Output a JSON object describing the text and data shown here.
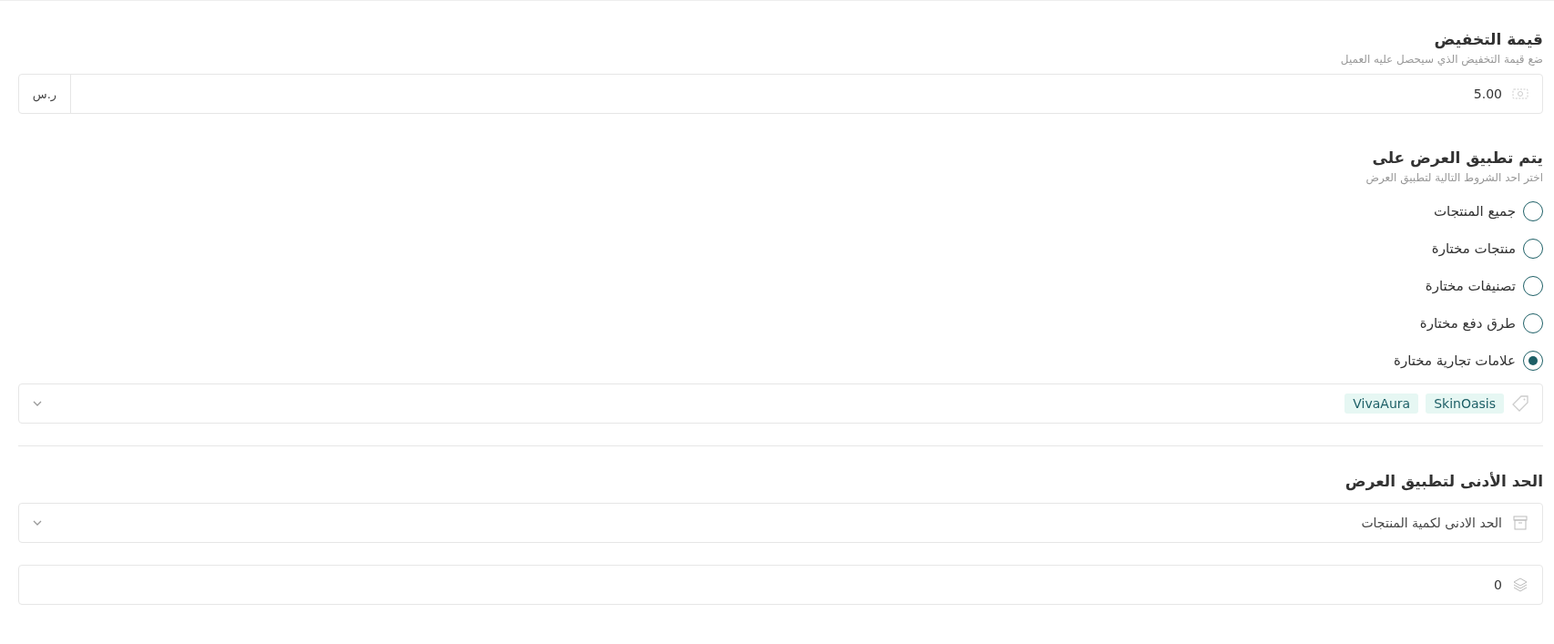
{
  "discount": {
    "title": "قيمة التخفيض",
    "hint": "ضع قيمة التخفيض الذي سيحصل عليه العميل",
    "value": "5.00",
    "unit": "ر.س"
  },
  "applies_to": {
    "title": "يتم تطبيق العرض على",
    "hint": "اختر احد الشروط التالية لتطبيق العرض",
    "options": [
      {
        "label": "جميع المنتجات",
        "selected": false
      },
      {
        "label": "منتجات مختارة",
        "selected": false
      },
      {
        "label": "تصنيفات مختارة",
        "selected": false
      },
      {
        "label": "طرق دفع مختارة",
        "selected": false
      },
      {
        "label": "علامات تجارية مختارة",
        "selected": true
      }
    ],
    "brand_tags": [
      "SkinOasis",
      "VivaAura"
    ]
  },
  "minimum": {
    "title": "الحد الأدنى لتطبيق العرض",
    "select_value": "الحد الادنى لكمية المنتجات",
    "quantity": "0"
  }
}
